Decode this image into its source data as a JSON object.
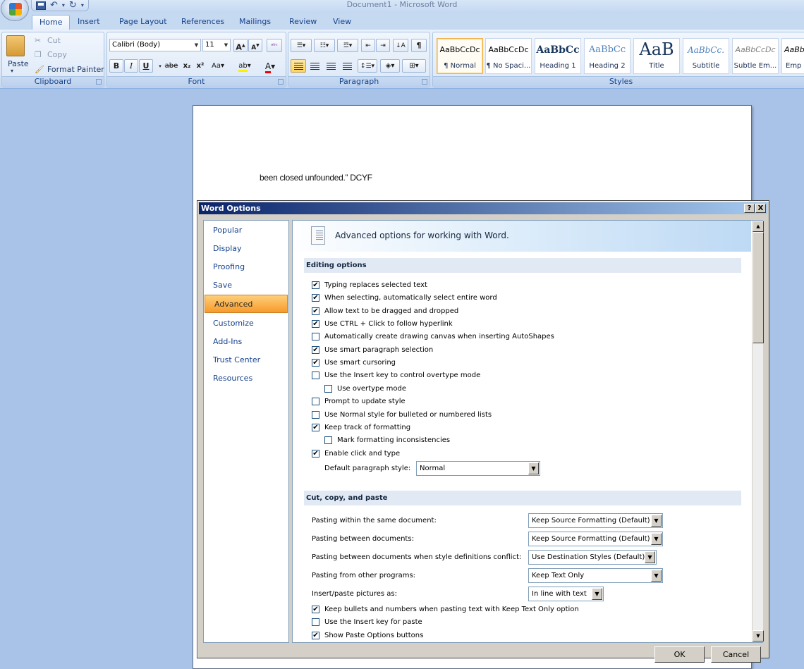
{
  "window": {
    "title": "Document1 - Microsoft Word"
  },
  "tabs": [
    "Home",
    "Insert",
    "Page Layout",
    "References",
    "Mailings",
    "Review",
    "View"
  ],
  "ribbon": {
    "clipboard": {
      "paste": "Paste",
      "cut": "Cut",
      "copy": "Copy",
      "format_painter": "Format Painter",
      "label": "Clipboard"
    },
    "font": {
      "name": "Calibri (Body)",
      "size": "11",
      "label": "Font"
    },
    "paragraph": {
      "label": "Paragraph"
    },
    "styles": {
      "label": "Styles",
      "items": [
        {
          "sample": "AaBbCcDc",
          "name": "¶ Normal"
        },
        {
          "sample": "AaBbCcDc",
          "name": "¶ No Spaci..."
        },
        {
          "sample": "AaBbCc",
          "name": "Heading 1"
        },
        {
          "sample": "AaBbCc",
          "name": "Heading 2"
        },
        {
          "sample": "AaB",
          "name": "Title"
        },
        {
          "sample": "AaBbCc.",
          "name": "Subtitle"
        },
        {
          "sample": "AaBbCcDc",
          "name": "Subtle Em..."
        },
        {
          "sample": "AaBb",
          "name": "Emp"
        }
      ]
    }
  },
  "document": {
    "text": "been closed unfounded.” DCYF"
  },
  "dialog": {
    "title": "Word Options",
    "help": "?",
    "close": "X",
    "nav": [
      "Popular",
      "Display",
      "Proofing",
      "Save",
      "Advanced",
      "Customize",
      "Add-Ins",
      "Trust Center",
      "Resources"
    ],
    "active_nav": "Advanced",
    "banner": "Advanced options for working with Word.",
    "editing": {
      "header": "Editing options",
      "options": [
        {
          "label": "Typing replaces selected text",
          "checked": true,
          "indent": false
        },
        {
          "label": "When selecting, automatically select entire word",
          "checked": true,
          "indent": false
        },
        {
          "label": "Allow text to be dragged and dropped",
          "checked": true,
          "indent": false
        },
        {
          "label": "Use CTRL + Click to follow hyperlink",
          "checked": true,
          "indent": false
        },
        {
          "label": "Automatically create drawing canvas when inserting AutoShapes",
          "checked": false,
          "indent": false
        },
        {
          "label": "Use smart paragraph selection",
          "checked": true,
          "indent": false
        },
        {
          "label": "Use smart cursoring",
          "checked": true,
          "indent": false
        },
        {
          "label": "Use the Insert key to control overtype mode",
          "checked": false,
          "indent": false
        },
        {
          "label": "Use overtype mode",
          "checked": false,
          "indent": true
        },
        {
          "label": "Prompt to update style",
          "checked": false,
          "indent": false
        },
        {
          "label": "Use Normal style for bulleted or numbered lists",
          "checked": false,
          "indent": false
        },
        {
          "label": "Keep track of formatting",
          "checked": true,
          "indent": false
        },
        {
          "label": "Mark formatting inconsistencies",
          "checked": false,
          "indent": true
        },
        {
          "label": "Enable click and type",
          "checked": true,
          "indent": false
        }
      ],
      "default_style_label": "Default paragraph style:",
      "default_style_value": "Normal"
    },
    "paste": {
      "header": "Cut, copy, and paste",
      "rows": [
        {
          "label": "Pasting within the same document:",
          "value": "Keep Source Formatting (Default)"
        },
        {
          "label": "Pasting between documents:",
          "value": "Keep Source Formatting (Default)"
        },
        {
          "label": "Pasting between documents when style definitions conflict:",
          "value": "Use Destination Styles (Default)"
        },
        {
          "label": "Pasting from other programs:",
          "value": "Keep Text Only"
        },
        {
          "label": "Insert/paste pictures as:",
          "value": "In line with text"
        }
      ],
      "options": [
        {
          "label": "Keep bullets and numbers when pasting text with Keep Text Only option",
          "checked": true
        },
        {
          "label": "Use the Insert key for paste",
          "checked": false
        },
        {
          "label": "Show Paste Options buttons",
          "checked": true
        }
      ]
    },
    "buttons": {
      "ok": "OK",
      "cancel": "Cancel"
    }
  }
}
